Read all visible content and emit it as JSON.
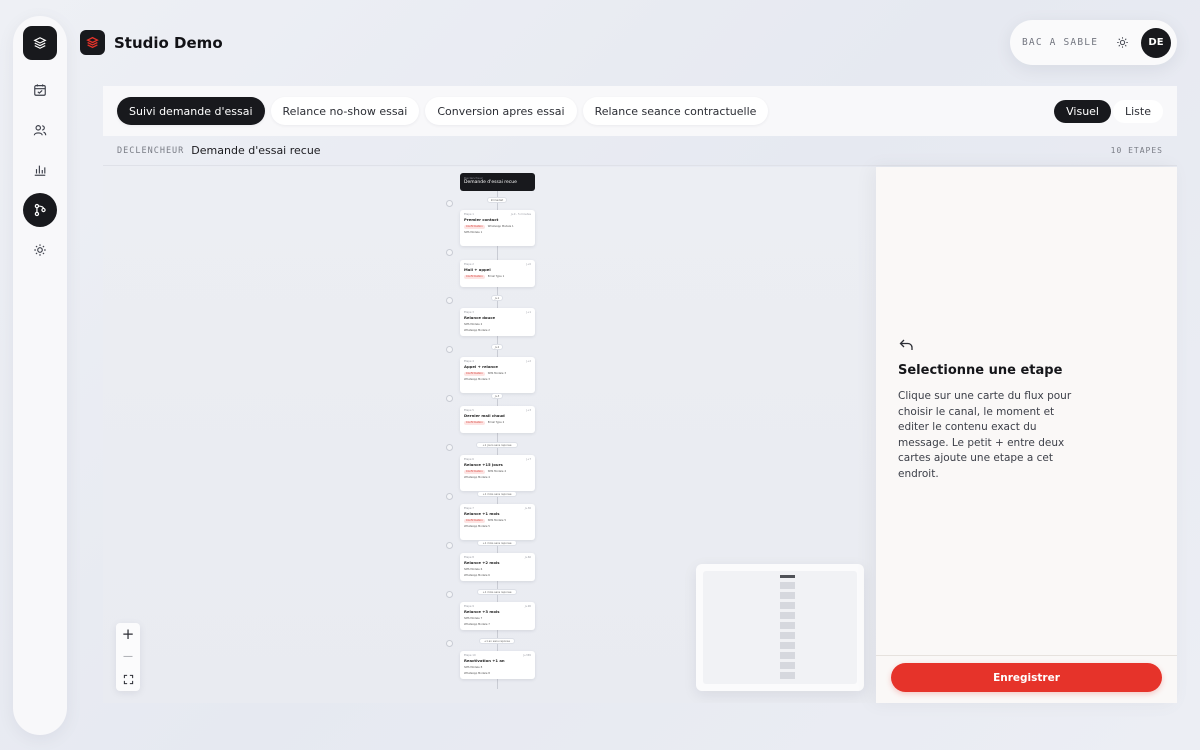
{
  "app": {
    "title": "Studio Demo"
  },
  "header": {
    "sandbox_label": "BAC A SABLE",
    "avatar_initials": "DE"
  },
  "sidebar": {
    "items": [
      {
        "name": "logo",
        "icon": "layers-icon"
      },
      {
        "name": "calendar",
        "icon": "calendar-check-icon"
      },
      {
        "name": "users",
        "icon": "users-icon"
      },
      {
        "name": "stats",
        "icon": "bar-chart-icon"
      },
      {
        "name": "flows",
        "icon": "flow-icon",
        "active": true
      },
      {
        "name": "settings",
        "icon": "sun-settings-icon"
      }
    ]
  },
  "tabs": [
    {
      "label": "Suivi demande d'essai",
      "active": true
    },
    {
      "label": "Relance no-show essai",
      "active": false
    },
    {
      "label": "Conversion apres essai",
      "active": false
    },
    {
      "label": "Relance seance contractuelle",
      "active": false
    }
  ],
  "view_toggle": {
    "visual": "Visuel",
    "list": "Liste"
  },
  "trigger_bar": {
    "label": "DECLENCHEUR",
    "value": "Demande d'essai recue",
    "step_count": "10 ETAPES"
  },
  "flow": {
    "trigger_card": {
      "caption": "Declencheur",
      "title": "Demande d'essai recue"
    },
    "steps": [
      {
        "label": "Etape 1",
        "meta": "J+0 - 5 minutes",
        "title": "Premier contact",
        "chip": "Confirmation",
        "channels": [
          "WhatsApp Modele 1",
          "SMS Modele 1"
        ]
      },
      {
        "label": "Etape 2",
        "meta": "J+0",
        "title": "Mail + appel",
        "chip": "Confirmation",
        "channels": [
          "Email Type 1"
        ]
      },
      {
        "label": "Etape 3",
        "meta": "J+1",
        "title": "Relance douce",
        "chip": "",
        "channels": [
          "SMS Modele 2",
          "WhatsApp Modele 2"
        ]
      },
      {
        "label": "Etape 4",
        "meta": "J+2",
        "title": "Appel + relance",
        "chip": "Confirmation",
        "channels": [
          "SMS Modele 3",
          "WhatsApp Modele 3"
        ]
      },
      {
        "label": "Etape 5",
        "meta": "J+3",
        "title": "Dernier mail chaud",
        "chip": "Confirmation",
        "channels": [
          "Email Type 2"
        ]
      },
      {
        "label": "Etape 6",
        "meta": "J+7",
        "title": "Relance +15 jours",
        "chip": "Confirmation",
        "channels": [
          "SMS Modele 4",
          "WhatsApp Modele 4"
        ]
      },
      {
        "label": "Etape 7",
        "meta": "J+30",
        "title": "Relance +1 mois",
        "chip": "Confirmation",
        "channels": [
          "SMS Modele 5",
          "WhatsApp Modele 5"
        ]
      },
      {
        "label": "Etape 8",
        "meta": "J+60",
        "title": "Relance +2 mois",
        "chip": "",
        "channels": [
          "SMS Modele 6",
          "WhatsApp Modele 6"
        ]
      },
      {
        "label": "Etape 9",
        "meta": "J+90",
        "title": "Relance +3 mois",
        "chip": "",
        "channels": [
          "SMS Modele 7",
          "WhatsApp Modele 7"
        ]
      },
      {
        "label": "Etape 10",
        "meta": "J+365",
        "title": "Reactivation +1 an",
        "chip": "",
        "channels": [
          "SMS Modele 8",
          "WhatsApp Modele 8"
        ]
      }
    ],
    "gaps": [
      "Immediat",
      "",
      "J+1",
      "J+2",
      "J+3",
      "+1 jours sans reponse",
      "+1 mois sans reponse",
      "+1 mois sans reponse",
      "+1 mois sans reponse",
      "+1 an sans reponse"
    ]
  },
  "zoom": {
    "in": "+",
    "out": "—",
    "fit": "fit-screen-icon"
  },
  "panel": {
    "title": "Selectionne une etape",
    "text": "Clique sur une carte du flux pour choisir le canal, le moment et editer le contenu exact du message. Le petit + entre deux cartes ajoute une etape a cet endroit.",
    "save_label": "Enregistrer"
  },
  "colors": {
    "accent": "#e6332a",
    "dark": "#18191d",
    "chip_red": "#fde4e3"
  }
}
